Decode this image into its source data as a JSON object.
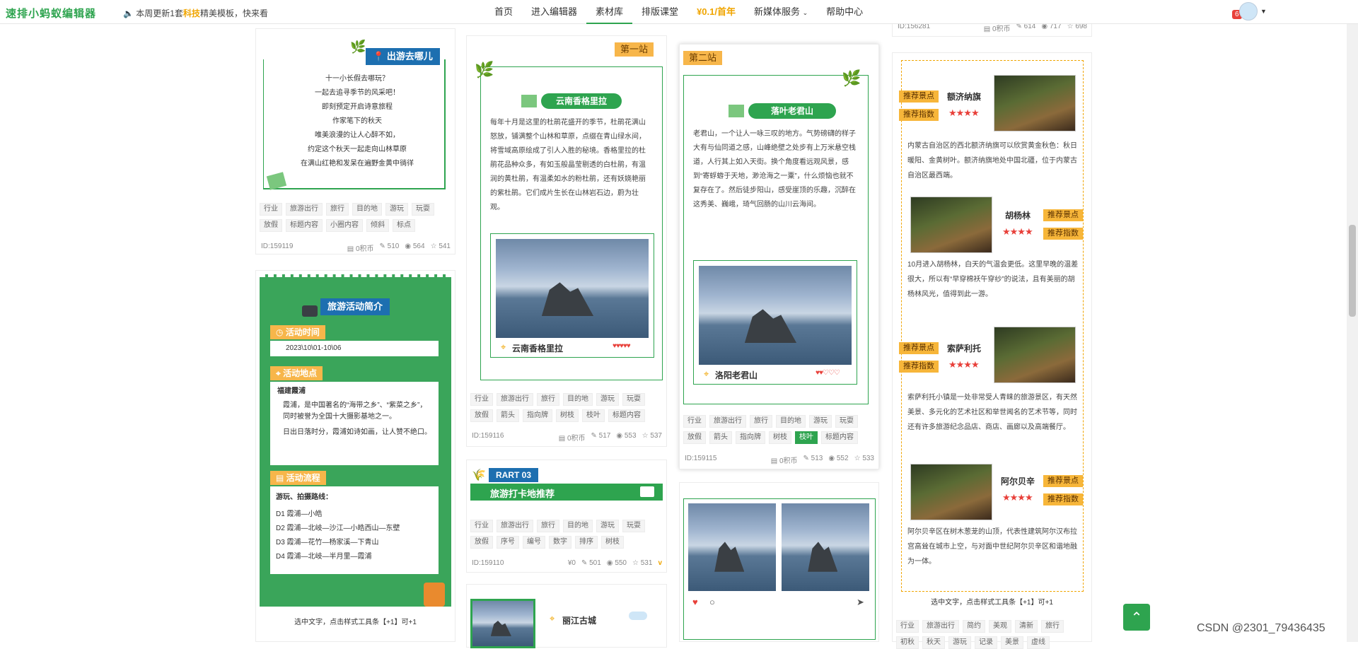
{
  "topbar": {
    "logo": "速排小蚂蚁编辑器",
    "notice_pre": "本周更新1套",
    "notice_hl": "科技",
    "notice_post": "精美模板，快来看",
    "nav": [
      "首页",
      "进入编辑器",
      "素材库",
      "排版课堂",
      "¥0.1/首年",
      "新媒体服务",
      "帮助中心"
    ],
    "badge": "6"
  },
  "col1": {
    "c1": {
      "title": "出游去哪儿",
      "lines": [
        "十一小长假去哪玩？",
        "一起去追寻季节的风采吧！",
        "即刻预定开启诗意旅程",
        "作家笔下的秋天",
        "唯美浪漫的让人心醉不如，",
        "约定这个秋天一起走向山林草原",
        "在满山红艳和发呆在遍野金黄中徜徉"
      ],
      "tags": [
        "行业",
        "旅游出行",
        "旅行",
        "目的地",
        "游玩",
        "玩耍",
        "放假",
        "标题内容",
        "小圈内容",
        "倾斜",
        "标点"
      ],
      "id": "ID:159119",
      "coins": "0积币",
      "edits": "510",
      "views": "564",
      "stars": "541"
    },
    "c2": {
      "title": "旅游活动简介",
      "time_label": "活动时间",
      "time_value": "2023\\10\\01-10\\06",
      "place_label": "活动地点",
      "place_head": "福建霞浦",
      "place_b1": "霞浦，是中国著名的“海带之乡”、“紫菜之乡”，同时被誉为全国十大摄影基地之一。",
      "place_b2": "日出日落时分，霞浦如诗如画，让人赞不绝口。",
      "flow_label": "活动流程",
      "flow_head": "游玩、拍摄路线：",
      "flow": [
        "D1 霞浦—小皓",
        "D2 霞浦—北岐—沙江—小皓西山—东壁",
        "D3 霞浦—花竹—杨家溪—下青山",
        "D4 霞浦—北岐—半月里—霞浦"
      ],
      "hint": "选中文字，点击样式工具条【+1】可+1"
    }
  },
  "col2": {
    "c1": {
      "station": "第一站",
      "title": "云南香格里拉",
      "text": "每年十月是这里的杜鹃花盛开的季节，杜鹃花满山怒放，铺满整个山林和草原，点缀在青山绿水间，将雪域高原绘成了引人入胜的秘境。香格里拉的杜鹃花品种众多，有如玉般晶莹剔透的白杜鹃，有温润的黄杜鹃，有温柔如水的粉杜鹃，还有妖娆艳丽的紫杜鹃。它们成片生长在山林岩石边，蔚为壮观。",
      "caption": "云南香格里拉",
      "hearts": "♥♥♥♥♥",
      "tags": [
        "行业",
        "旅游出行",
        "旅行",
        "目的地",
        "游玩",
        "玩耍",
        "放假",
        "箭头",
        "指向牌",
        "树枝",
        "枝叶",
        "标题内容"
      ],
      "id": "ID:159116",
      "coins": "0积币",
      "edits": "517",
      "views": "553",
      "stars": "537"
    },
    "c2": {
      "part": "RART 03",
      "title": "旅游打卡地推荐",
      "tags": [
        "行业",
        "旅游出行",
        "旅行",
        "目的地",
        "游玩",
        "玩耍",
        "放假",
        "序号",
        "编号",
        "数字",
        "排序",
        "树枝"
      ],
      "id": "ID:159110",
      "coins": "0",
      "edits": "501",
      "views": "550",
      "stars": "531"
    },
    "c3": {
      "caption": "丽江古城"
    }
  },
  "col3": {
    "c1": {
      "station": "第二站",
      "title": "落叶老君山",
      "text": "老君山，一个让人一咏三叹的地方。气势磅礴的样子大有与仙同道之感，山峰绝壁之处步有上万米悬空栈道，人行其上如入天街。换个角度看远观风景，感到“寄蜉蝣于天地，渺沧海之一粟”，什么烦恼也就不复存在了。然后徒步阳山，感受崖顶的乐趣，沉醉在这秀美、巍峨，琦气回肠的山川云海间。",
      "caption": "洛阳老君山",
      "hearts": "♥♥♡♡♡",
      "tags": [
        "行业",
        "旅游出行",
        "旅行",
        "目的地",
        "游玩",
        "玩耍",
        "放假",
        "箭头",
        "指向牌",
        "树枝",
        "枝叶",
        "标题内容"
      ],
      "active_tag": "枝叶",
      "id": "ID:159115",
      "coins": "0积币",
      "edits": "513",
      "views": "552",
      "stars": "533"
    }
  },
  "col4": {
    "top_stats": {
      "id": "ID:156281",
      "coins": "0积币",
      "edits": "614",
      "views": "717",
      "stars": "698"
    },
    "pill1": "推荐景点",
    "pill2": "推荐指数",
    "items": [
      {
        "name": "额济纳旗",
        "text": "内蒙古自治区的西北额济纳旗可以欣赏黄金秋色：秋日暖阳、金黄树叶。额济纳旗地处中国北疆，位于内蒙古自治区最西端。"
      },
      {
        "name": "胡杨林",
        "text": "10月进入胡杨林，白天的气温会更低。这里早晚的温差很大，所以有“早穿棉袄午穿纱”的说法，且有美丽的胡杨林风光，值得到此一游。"
      },
      {
        "name": "索萨利托",
        "text": "索萨利托小镇是一处非常受人青睐的旅游景区，有天然美景、多元化的艺术社区和举世闻名的艺术节等，同时还有许多旅游纪念品店、商店、画廊以及高端餐厅。"
      },
      {
        "name": "阿尔贝辛",
        "text": "阿尔贝辛区在树木葱茏的山顶，代表性建筑阿尔汉布拉宫高耸在城市上空，与对面中世纪阿尔贝辛区和谐地融为一体。"
      }
    ],
    "rating": "★★★★",
    "hint": "选中文字，点击样式工具条【+1】可+1",
    "tags": [
      "行业",
      "旅游出行",
      "简约",
      "美观",
      "清新",
      "旅行",
      "初秋",
      "秋天",
      "游玩",
      "记录",
      "美景",
      "虚线"
    ]
  },
  "watermark": "CSDN @2301_79436435",
  "colors": {
    "green": "#2ea44f",
    "orange": "#f7b64a",
    "blue": "#1d6fb0",
    "red": "#e8403a"
  }
}
